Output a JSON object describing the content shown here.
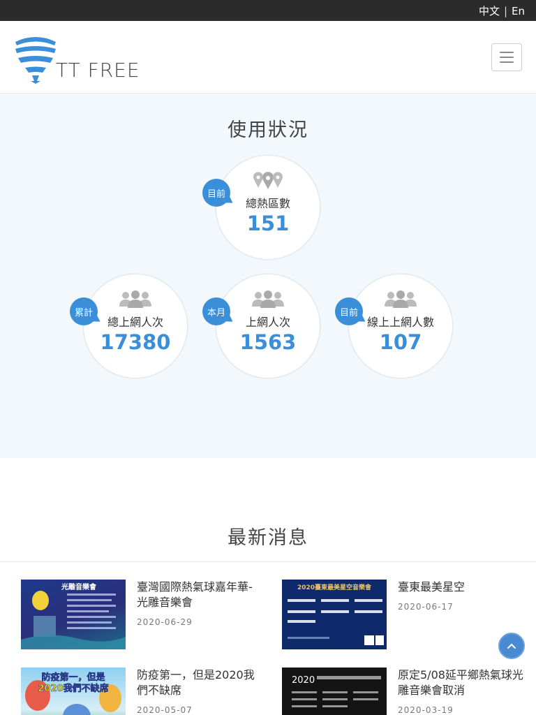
{
  "topbar": {
    "lang_zh": "中文",
    "separator": "|",
    "lang_en": "En"
  },
  "header": {
    "logo_text": "TT FREE",
    "menu_icon": "hamburger-icon"
  },
  "usage": {
    "title": "使用狀況",
    "stats": [
      {
        "badge": "目前",
        "label": "總熱區數",
        "value": "151",
        "icon": "map-pin-icon"
      },
      {
        "badge": "累計",
        "label": "總上網人次",
        "value": "17380",
        "icon": "users-icon"
      },
      {
        "badge": "本月",
        "label": "上網人次",
        "value": "1563",
        "icon": "users-icon"
      },
      {
        "badge": "目前",
        "label": "線上上網人數",
        "value": "107",
        "icon": "users-icon"
      }
    ]
  },
  "news": {
    "title": "最新消息",
    "items": [
      {
        "title": "臺灣國際熱氣球嘉年華-光雕音樂會",
        "date": "2020-06-29"
      },
      {
        "title": "臺東最美星空",
        "date": "2020-06-17"
      },
      {
        "title": "防疫第一，但是2020我們不缺席",
        "date": "2020-05-07"
      },
      {
        "title": "原定5/08延平鄉熱氣球光雕音樂會取消",
        "date": "2020-03-19"
      }
    ],
    "thumbs": {
      "t1_heading": "光雕音樂會",
      "t2_heading": "2020臺東最美星空音樂會",
      "t3_heading_1": "防疫第一，但是",
      "t3_heading_2": "2020我們不缺席",
      "t4_heading": "2020"
    }
  },
  "colors": {
    "accent": "#3b8ed8",
    "topbar": "#2b2b2b",
    "usage_bg": "#f3f8fc"
  },
  "scroll_top_icon": "chevron-up-icon"
}
